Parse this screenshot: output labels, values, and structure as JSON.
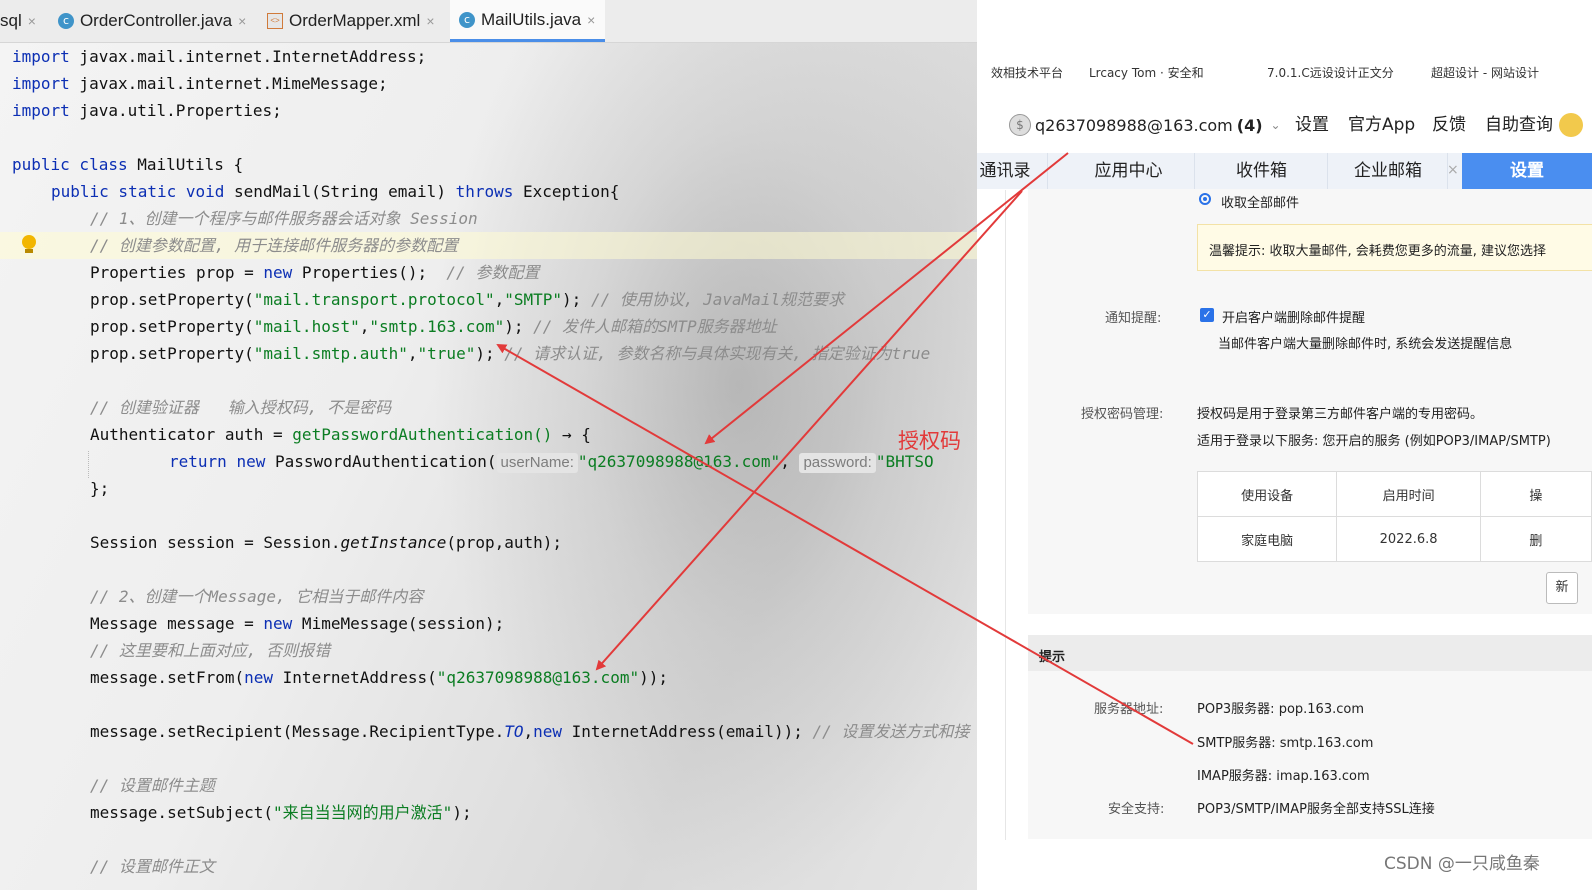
{
  "ide": {
    "tabs": [
      {
        "label": "sql",
        "icon": "sql-file-icon"
      },
      {
        "label": "OrderController.java",
        "icon": "java-class-icon"
      },
      {
        "label": "OrderMapper.xml",
        "icon": "xml-file-icon"
      },
      {
        "label": "MailUtils.java",
        "icon": "java-class-icon"
      }
    ],
    "close_glyph": "×",
    "code": {
      "l1_kw": "import",
      "l1_rest": " javax.mail.internet.InternetAddress;",
      "l2_kw": "import",
      "l2_rest": " javax.mail.internet.MimeMessage;",
      "l3_kw": "import",
      "l3_rest": " java.util.Properties;",
      "l5_kw": "public class",
      "l5_rest": " MailUtils {",
      "l6_kw1": "public static void",
      "l6_mid": " sendMail(String email) ",
      "l6_kw2": "throws",
      "l6_rest": " Exception{",
      "c1": "// 1、创建一个程序与邮件服务器会话对象 Session",
      "c2": "// 创建参数配置, 用于连接邮件服务器的参数配置",
      "l9_a": "Properties prop = ",
      "l9_kw": "new",
      "l9_b": " Properties();  ",
      "l9_c": "// 参数配置",
      "l10_a": "prop.setProperty(",
      "l10_s1": "\"mail.transport.protocol\"",
      "l10_b": ",",
      "l10_s2": "\"SMTP\"",
      "l10_c": "); ",
      "l10_cm": "// 使用协议, JavaMail规范要求",
      "l11_a": "prop.setProperty(",
      "l11_s1": "\"mail.host\"",
      "l11_b": ",",
      "l11_s2": "\"smtp.163.com\"",
      "l11_c": "); ",
      "l11_cm": "// 发件人邮箱的SMTP服务器地址",
      "l12_a": "prop.setProperty(",
      "l12_s1": "\"mail.smtp.auth\"",
      "l12_b": ",",
      "l12_s2": "\"true\"",
      "l12_c": "); ",
      "l12_cm": "// 请求认证, 参数名称与具体实现有关, 指定验证为true",
      "c3": "// 创建验证器   输入授权码, 不是密码",
      "l15_a": "Authenticator auth = ",
      "l15_m": "getPasswordAuthentication()",
      "l15_b": " → {",
      "l16_kw1": "return",
      "l16_sp": " ",
      "l16_kw2": "new",
      "l16_a": " PasswordAuthentication(",
      "l16_h1": "userName:",
      "l16_s1": "\"q2637098988@163.com\"",
      "l16_b": ", ",
      "l16_h2": "password:",
      "l16_s2": "\"BHTSO",
      "l17": "};",
      "l19_a": "Session session = Session.",
      "l19_it": "getInstance",
      "l19_b": "(prop,auth);",
      "c4": "// 2、创建一个Message, 它相当于邮件内容",
      "l22_a": "Message message = ",
      "l22_kw": "new",
      "l22_b": " MimeMessage(session);",
      "c5": "// 这里要和上面对应, 否则报错",
      "l24_a": "message.setFrom(",
      "l24_kw": "new",
      "l24_b": " InternetAddress(",
      "l24_s": "\"q2637098988@163.com\"",
      "l24_c": "));",
      "l26_a": "message.setRecipient(Message.RecipientType.",
      "l26_it": "TO",
      "l26_b": ",",
      "l26_kw": "new",
      "l26_c": " InternetAddress(email)); ",
      "l26_cm": "// 设置发送方式和接",
      "c6": "// 设置邮件主题",
      "l29_a": "message.setSubject(",
      "l29_s": "\"来自当当网的用户激活\"",
      "l29_b": ");",
      "c7": "// 设置邮件正文"
    }
  },
  "annotation": {
    "label": "授权码",
    "color": "#e23a3a"
  },
  "mail": {
    "bookmarks": [
      "效相技术平台",
      "Lrcacy Tom · 安全和",
      "7.0.1.C远设设计正文分",
      "超超设计 - 网站设计"
    ],
    "account": {
      "email": "q2637098988@163.com",
      "count": "(4)",
      "icon": "coin-icon"
    },
    "top_links": [
      "设置",
      "官方App",
      "反馈",
      "自助查询"
    ],
    "nav_tabs": [
      {
        "label": "通讯录",
        "active": false
      },
      {
        "label": "应用中心",
        "active": false
      },
      {
        "label": "收件箱",
        "active": false
      },
      {
        "label": "企业邮箱",
        "active": false,
        "close": "×"
      },
      {
        "label": "设置",
        "active": true
      }
    ],
    "receive_option": "收取全部邮件",
    "warm_tip": "温馨提示: 收取大量邮件, 会耗费您更多的流量, 建议您选择",
    "notify": {
      "label": "通知提醒:",
      "checkbox": "开启客户端删除邮件提醒",
      "desc": "当邮件客户端大量删除邮件时, 系统会发送提醒信息"
    },
    "auth": {
      "label": "授权密码管理:",
      "line1": "授权码是用于登录第三方邮件客户端的专用密码。",
      "line2": "适用于登录以下服务: 您开启的服务 (例如POP3/IMAP/SMTP)"
    },
    "device_table": {
      "headers": [
        "使用设备",
        "启用时间",
        "操"
      ],
      "rows": [
        [
          "家庭电脑",
          "2022.6.8",
          "删"
        ]
      ]
    },
    "new_button": "新",
    "tips": {
      "title": "提示",
      "server_label": "服务器地址:",
      "pop3": "POP3服务器: pop.163.com",
      "smtp": "SMTP服务器: smtp.163.com",
      "imap": "IMAP服务器: imap.163.com",
      "security_label": "安全支持:",
      "security": "POP3/SMTP/IMAP服务全部支持SSL连接"
    },
    "watermark": "CSDN @一只咸鱼秦"
  }
}
